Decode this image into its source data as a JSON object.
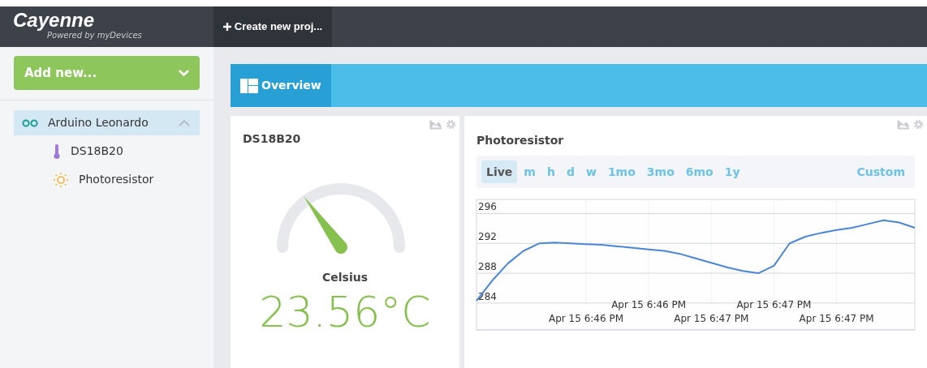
{
  "header": {
    "logo": "Cayenne",
    "tagline": "Powered by myDevices",
    "project_tab": "Create new proj..."
  },
  "sidebar": {
    "add_button": "Add new...",
    "tree": [
      {
        "label": "Arduino Leonardo",
        "kind": "board",
        "selected": true,
        "expanded": true,
        "children": [
          {
            "label": "DS18B20",
            "kind": "thermometer",
            "selected": false
          },
          {
            "label": "Photoresistor",
            "kind": "light",
            "selected": false
          }
        ]
      }
    ]
  },
  "tabs": [
    {
      "label": "Overview",
      "selected": true
    }
  ],
  "widgets": [
    {
      "kind": "gauge",
      "title": "DS18B20",
      "unit": "Celsius",
      "value": "23.56°C"
    },
    {
      "kind": "chart",
      "title": "Photoresistor",
      "ranges": [
        {
          "label": "Live",
          "selected": true
        },
        {
          "label": "m",
          "selected": false
        },
        {
          "label": "h",
          "selected": false
        },
        {
          "label": "d",
          "selected": false
        },
        {
          "label": "w",
          "selected": false
        },
        {
          "label": "1mo",
          "selected": false
        },
        {
          "label": "3mo",
          "selected": false
        },
        {
          "label": "6mo",
          "selected": false
        },
        {
          "label": "1y",
          "selected": false
        }
      ],
      "custom": "Custom",
      "chart_data": {
        "type": "line",
        "categories": [
          null,
          null,
          null,
          null,
          null,
          null,
          null,
          "Apr 15 6:46 PM",
          null,
          null,
          null,
          "Apr 15 6:46 PM",
          null,
          null,
          null,
          "Apr 15 6:47 PM",
          null,
          null,
          null,
          "Apr 15 6:47 PM",
          null,
          null,
          null,
          "Apr 15 6:47 PM",
          null,
          null,
          null,
          null,
          null
        ],
        "series": [
          {
            "color": "#4a86d4",
            "values": [
              284.3,
              287.0,
              289.3,
              291.0,
              292.0,
              292.1,
              292.0,
              291.9,
              291.8,
              291.6,
              291.4,
              291.2,
              291.0,
              290.6,
              290.0,
              289.4,
              288.8,
              288.3,
              288.0,
              289.0,
              292.0,
              292.9,
              293.4,
              293.8,
              294.1,
              294.6,
              295.1,
              294.8,
              294.1
            ]
          }
        ],
        "ylim": [
          280.4,
          297.9
        ],
        "yticks": [
          284,
          288,
          292,
          296
        ],
        "grid": true
      }
    }
  ]
}
